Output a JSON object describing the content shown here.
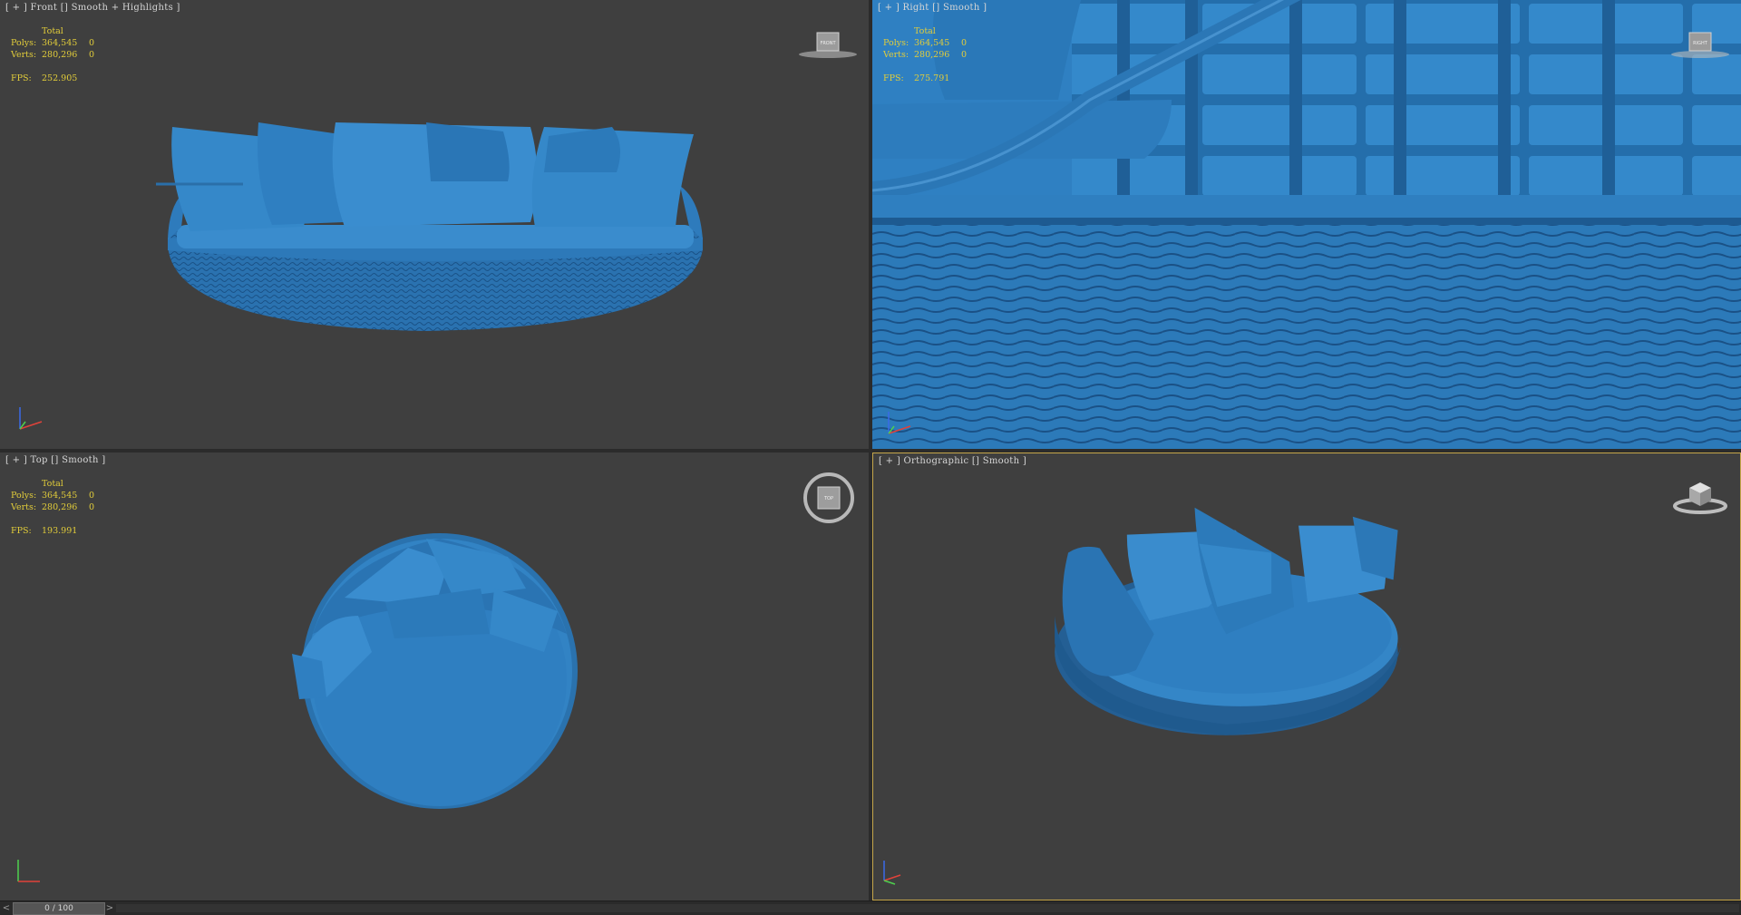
{
  "viewports": {
    "front": {
      "label": "[ + ] Front [] Smooth + Highlights ]",
      "stats": {
        "total": "Total",
        "polys_label": "Polys:",
        "polys_value": "364,545",
        "polys_sel": "0",
        "verts_label": "Verts:",
        "verts_value": "280,296",
        "verts_sel": "0",
        "fps_label": "FPS:",
        "fps_value": "252.905"
      },
      "viewcube_text": "FRONT"
    },
    "right": {
      "label": "[ + ] Right [] Smooth ]",
      "stats": {
        "total": "Total",
        "polys_label": "Polys:",
        "polys_value": "364,545",
        "polys_sel": "0",
        "verts_label": "Verts:",
        "verts_value": "280,296",
        "verts_sel": "0",
        "fps_label": "FPS:",
        "fps_value": "275.791"
      },
      "viewcube_text": "RIGHT"
    },
    "top": {
      "label": "[ + ] Top [] Smooth ]",
      "stats": {
        "total": "Total",
        "polys_label": "Polys:",
        "polys_value": "364,545",
        "polys_sel": "0",
        "verts_label": "Verts:",
        "verts_value": "280,296",
        "verts_sel": "0",
        "fps_label": "FPS:",
        "fps_value": "193.991"
      },
      "viewcube_text": "TOP"
    },
    "ortho": {
      "label": "[ + ] Orthographic [] Smooth ]"
    }
  },
  "timeline": {
    "frame": "0 / 100",
    "prev": "<",
    "next": ">"
  },
  "colors": {
    "model_blue": "#2f7fc1",
    "viewport_bg": "#3f3f3f",
    "stats_yellow": "#e2cd3a",
    "active_border": "#c6a64a"
  },
  "icons": {
    "viewcube": "viewcube-icon",
    "axis": "axis-tripod-icon"
  }
}
